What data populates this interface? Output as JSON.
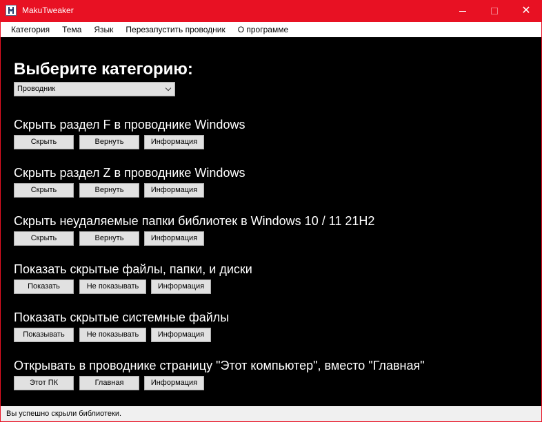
{
  "window": {
    "title": "MakuTweaker",
    "accent_color": "#e81123",
    "controls": {
      "minimize": "—",
      "maximize": "☐",
      "close": "✕"
    }
  },
  "menu": [
    "Категория",
    "Тема",
    "Язык",
    "Перезапустить проводник",
    "О программе"
  ],
  "main": {
    "heading": "Выберите категорию:",
    "category_select": {
      "value": "Проводник"
    }
  },
  "sections": [
    {
      "title": "Скрыть раздел F в проводнике Windows",
      "buttons": [
        "Скрыть",
        "Вернуть",
        "Информация"
      ]
    },
    {
      "title": "Скрыть раздел Z в проводнике Windows",
      "buttons": [
        "Скрыть",
        "Вернуть",
        "Информация"
      ]
    },
    {
      "title": "Скрыть неудаляемые папки библиотек в Windows 10 / 11 21H2",
      "buttons": [
        "Скрыть",
        "Вернуть",
        "Информация"
      ]
    },
    {
      "title": "Показать скрытые файлы, папки, и диски",
      "buttons": [
        "Показать",
        "Не показывать",
        "Информация"
      ]
    },
    {
      "title": "Показать скрытые системные файлы",
      "buttons": [
        "Показывать",
        "Не показывать",
        "Информация"
      ]
    },
    {
      "title": "Открывать в проводнике страницу \"Этот компьютер\", вместо \"Главная\"",
      "buttons": [
        "Этот ПК",
        "Главная",
        "Информация"
      ]
    }
  ],
  "status": {
    "text": "Вы успешно скрыли библиотеки."
  }
}
